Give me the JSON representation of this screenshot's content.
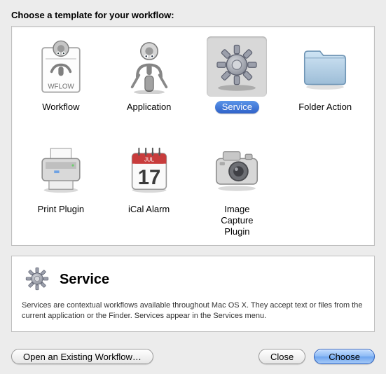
{
  "heading": "Choose a template for your workflow:",
  "templates": {
    "workflow": "Workflow",
    "application": "Application",
    "service": "Service",
    "folder_action": "Folder Action",
    "print_plugin": "Print Plugin",
    "ical_alarm": "iCal Alarm",
    "image_capture": "Image Capture Plugin"
  },
  "selected": {
    "title": "Service",
    "description": "Services are contextual workflows available throughout Mac OS X. They accept text or files from the current application or the Finder. Services appear in the Services menu."
  },
  "buttons": {
    "open_existing": "Open an Existing Workflow…",
    "close": "Close",
    "choose": "Choose"
  }
}
